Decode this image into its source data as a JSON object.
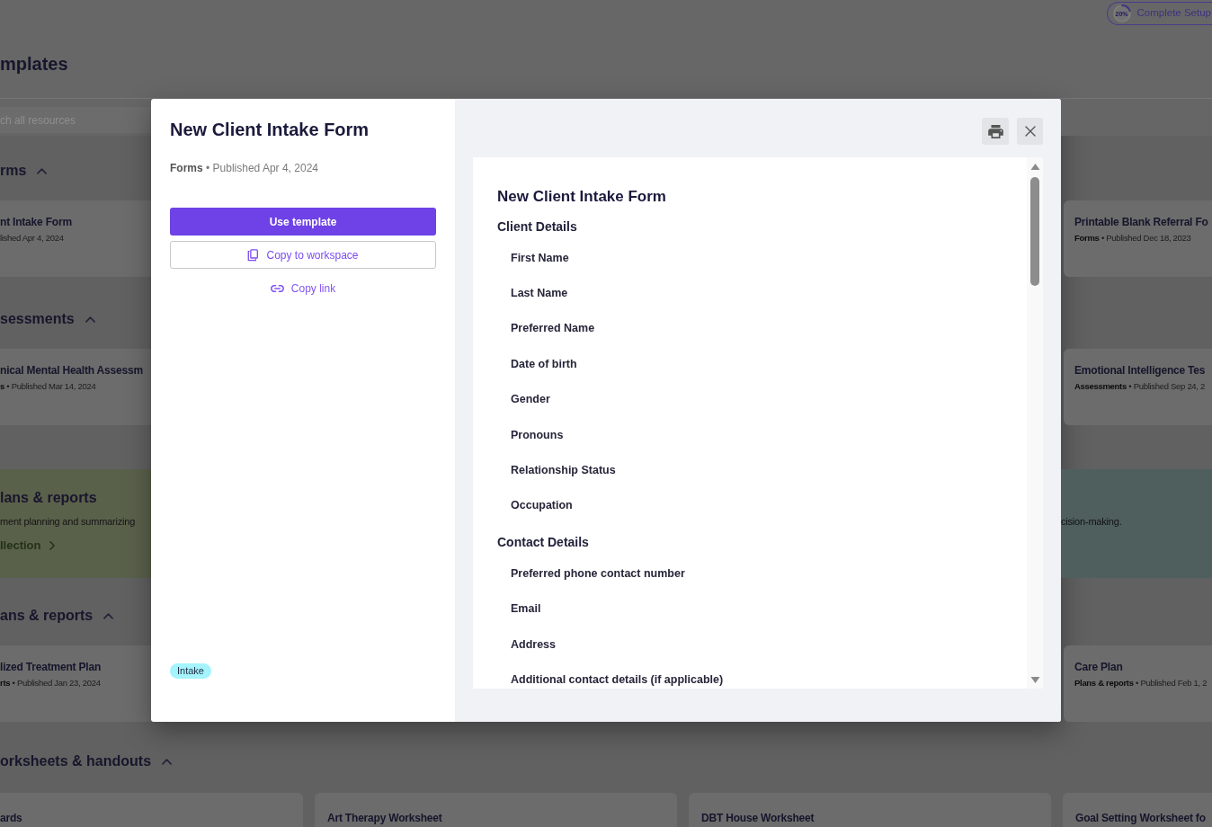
{
  "header": {
    "title": "mplates",
    "setup": {
      "percent": "20%",
      "level": 0.2,
      "label": "Complete Setup"
    }
  },
  "search": {
    "placeholder": "ch all resources"
  },
  "feed": [
    {
      "kind": "section",
      "title": "rms",
      "expanded": true,
      "cards": [
        {
          "title": "nt Intake Form",
          "meta": "lished Apr 4, 2024"
        },
        {
          "title": "Printable Blank Referral Fo",
          "meta": "**Forms** • Published Dec 18, 2023"
        }
      ]
    },
    {
      "kind": "section",
      "title": "sessments",
      "expanded": true,
      "cards": [
        {
          "title": "nical Mental Health Assessm",
          "meta": "**s** • Published Mar 14, 2024"
        },
        {
          "title": "Emotional Intelligence Tes",
          "meta": "**Assessments** • Published Sep 24, 2"
        }
      ]
    },
    {
      "kind": "collections",
      "items": [
        {
          "title": "lans & reports",
          "description": "ment planning and summarizing",
          "link": "llection",
          "color": "#5a614b"
        },
        {
          "description": "cision-making.",
          "color": "#4f5f5d"
        }
      ]
    },
    {
      "kind": "section",
      "title": "ans & reports",
      "expanded": true,
      "cards": [
        {
          "title": "lized Treatment Plan",
          "meta": "**rts** • Published Jan 23, 2024"
        },
        {
          "title": "Care Plan",
          "meta": "**Plans & reports** • Published Feb 1, 2"
        }
      ]
    },
    {
      "kind": "section",
      "title": "orksheets & handouts",
      "expanded": true,
      "cards": [
        {
          "title": "ards"
        },
        {
          "title": "Art Therapy Worksheet"
        },
        {
          "title": "DBT House Worksheet"
        },
        {
          "title": "Goal Setting Worksheet fo"
        }
      ]
    }
  ],
  "modal": {
    "title": "New Client Intake Form",
    "meta": "**Forms** • Published Apr 4, 2024",
    "actions": [
      {
        "kind": "primary",
        "label": "Use template"
      },
      {
        "kind": "outline",
        "label": "Copy to workspace"
      },
      {
        "kind": "link",
        "label": "Copy link"
      }
    ],
    "tags": [
      "Intake"
    ],
    "preview": {
      "title": "New Client Intake Form",
      "sections": [
        {
          "heading": "Client Details",
          "fields": [
            "First Name",
            "Last Name",
            "Preferred Name",
            "Date of birth",
            "Gender",
            "Pronouns",
            "Relationship Status",
            "Occupation"
          ]
        },
        {
          "heading": "Contact Details",
          "fields": [
            "Preferred phone contact number",
            "Email",
            "Address",
            "Additional contact details (if applicable)"
          ]
        }
      ]
    }
  }
}
